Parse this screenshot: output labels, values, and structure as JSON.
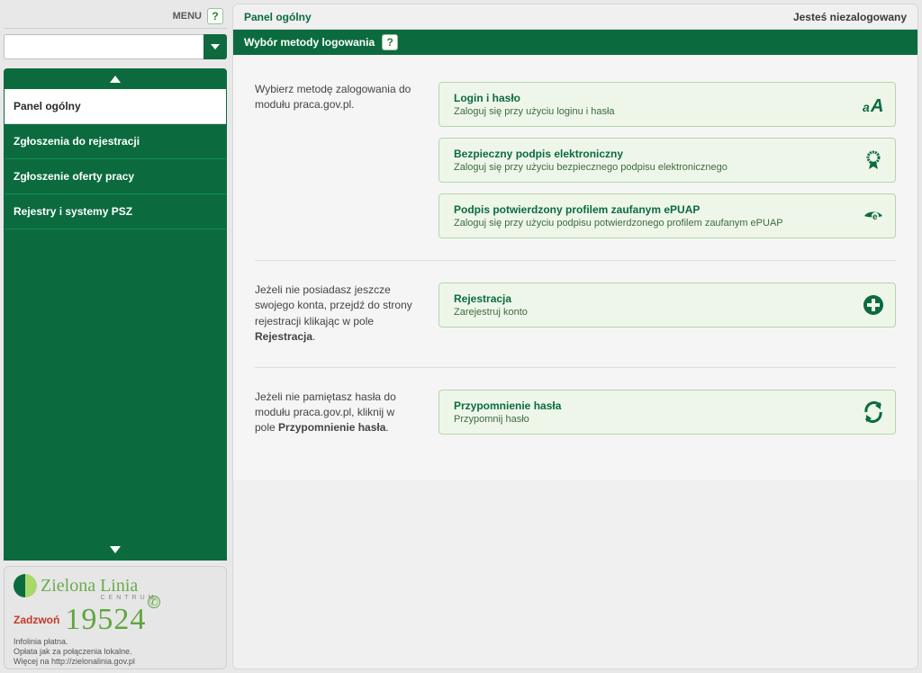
{
  "topbar": {
    "menu_label": "MENU"
  },
  "search": {
    "placeholder": ""
  },
  "sidebar": {
    "items": [
      {
        "label": "Panel ogólny",
        "active": true
      },
      {
        "label": "Zgłoszenia do rejestracji"
      },
      {
        "label": "Zgłoszenie oferty pracy"
      },
      {
        "label": "Rejestry i systemy PSZ"
      }
    ]
  },
  "promo": {
    "title": "Zielona Linia",
    "subtitle": "CENTRUM",
    "call": "Zadzwoń",
    "number": "19524",
    "line1": "Infolinia płatna.",
    "line2": "Opłata jak za połączenia lokalne.",
    "line3": "Więcej na http://zielonalinia.gov.pl"
  },
  "header": {
    "title": "Panel ogólny",
    "status": "Jesteś niezalogowany",
    "subtitle": "Wybór metody logowania"
  },
  "sections": [
    {
      "desc_plain": "Wybierz metodę zalogowania do modułu praca.gov.pl.",
      "desc_bold": "",
      "options": [
        {
          "title": "Login i hasło",
          "sub": "Zaloguj się przy użyciu loginu i hasła",
          "icon": "aa"
        },
        {
          "title": "Bezpieczny podpis elektroniczny",
          "sub": "Zaloguj się przy użyciu bezpiecznego podpisu elektronicznego",
          "icon": "cert"
        },
        {
          "title": "Podpis potwierdzony profilem zaufanym ePUAP",
          "sub": "Zaloguj się przy użyciu podpisu potwierdzonego profilem zaufanym ePUAP",
          "icon": "eye"
        }
      ]
    },
    {
      "desc_plain": "Jeżeli nie posiadasz jeszcze swojego konta, przejdź do strony rejestracji klikając w pole ",
      "desc_bold": "Rejestracja",
      "options": [
        {
          "title": "Rejestracja",
          "sub": "Zarejestruj konto",
          "icon": "plus"
        }
      ]
    },
    {
      "desc_plain": "Jeżeli nie pamiętasz hasła do modułu praca.gov.pl, kliknij w pole ",
      "desc_bold": "Przypomnienie hasła",
      "options": [
        {
          "title": "Przypomnienie hasła",
          "sub": "Przypomnij hasło",
          "icon": "refresh"
        }
      ]
    }
  ]
}
